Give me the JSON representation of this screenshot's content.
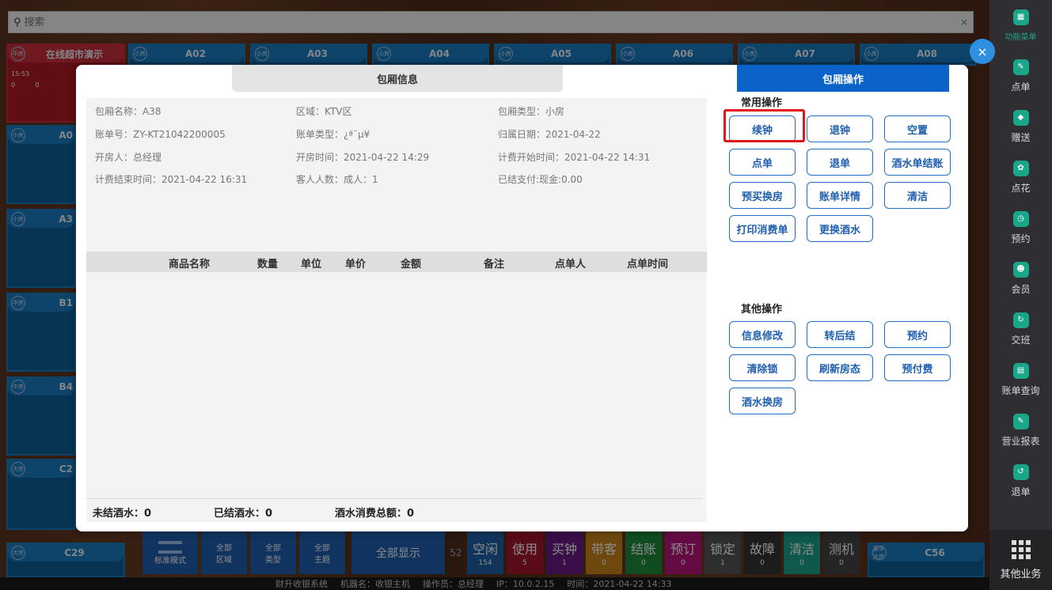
{
  "search": {
    "placeholder": "搜索",
    "clear": "×"
  },
  "tiles_top": [
    {
      "badge": "中房",
      "name": "在线超市演示",
      "time": "15:53",
      "c1": "0",
      "c2": "0"
    },
    {
      "badge": "小房",
      "name": "A02"
    },
    {
      "badge": "小房",
      "name": "A03"
    },
    {
      "badge": "小房",
      "name": "A04"
    },
    {
      "badge": "小房",
      "name": "A05"
    },
    {
      "badge": "小房",
      "name": "A06"
    },
    {
      "badge": "小房",
      "name": "A07"
    },
    {
      "badge": "小房",
      "name": "A08"
    }
  ],
  "tiles_left": [
    {
      "badge": "小房",
      "name": "A0"
    },
    {
      "badge": "小房",
      "name": "A3"
    },
    {
      "badge": "中房",
      "name": "B1"
    },
    {
      "badge": "中房",
      "name": "B4"
    },
    {
      "badge": "大房",
      "name": "C2"
    },
    {
      "badge": "大房",
      "name": "C29"
    }
  ],
  "tile_right_bottom": {
    "badge": "豪华大房",
    "name": "C56"
  },
  "sidebar": {
    "items": [
      "功能菜单",
      "点单",
      "赠送",
      "点花",
      "预约",
      "会员",
      "交班",
      "账单查询",
      "营业报表",
      "退单"
    ],
    "bottom": "其他业务"
  },
  "toolbar": {
    "mode": "标准模式",
    "area": [
      "全部",
      "区域"
    ],
    "type": [
      "全部",
      "类型"
    ],
    "theme": [
      "全部",
      "主题"
    ],
    "show_all": "全部显示",
    "stats": [
      {
        "label": "空闲",
        "count": "154",
        "color": "#1f5fa6"
      },
      {
        "label": "使用",
        "count": "5",
        "color": "#a3142a"
      },
      {
        "label": "买钟",
        "count": "1",
        "color": "#6b1b86"
      },
      {
        "label": "带客",
        "count": "0",
        "color": "#c8841a"
      },
      {
        "label": "结账",
        "count": "0",
        "color": "#1f8a3c"
      },
      {
        "label": "预订",
        "count": "0",
        "color": "#b9157c"
      },
      {
        "label": "锁定",
        "count": "1",
        "color": "#555555"
      },
      {
        "label": "故障",
        "count": "0",
        "color": "#333333"
      },
      {
        "label": "清洁",
        "count": "0",
        "color": "#1aa08a"
      },
      {
        "label": "测机",
        "count": "0",
        "color": "#444444"
      }
    ],
    "stat_partial": "52"
  },
  "statusbar": [
    "财升收银系统",
    "机器名：收银主机",
    "操作员：总经理",
    "IP：10.0.2.15",
    "时间：2021-04-22 14:33"
  ],
  "modal": {
    "info_title": "包厢信息",
    "info": {
      "room_name": "包厢名称：A38",
      "area": "区域：KTV区",
      "room_type": "包厢类型：小房",
      "bill_no": "账单号：ZY-KT21042200005",
      "bill_type": "账单类型：¿ª¨µ¥",
      "belong_date": "归属日期：2021-04-22",
      "opener": "开房人：总经理",
      "open_time": "开房时间：2021-04-22 14:29",
      "charge_start": "计费开始时间：2021-04-22 14:31",
      "charge_end": "计费结束时间：2021-04-22 16:31",
      "guests": "客人人数：成人：1",
      "paid": "已结支付:现金:0.00"
    },
    "columns": [
      "商品名称",
      "数量",
      "单位",
      "单价",
      "金额",
      "备注",
      "点单人",
      "点单时间"
    ],
    "footer": {
      "unsettled": "未结酒水：0",
      "settled": "已结酒水：0",
      "total": "酒水消费总额：0"
    },
    "ops_title": "包厢操作",
    "common_title": "常用操作",
    "common_ops": [
      "续钟",
      "退钟",
      "空置",
      "点单",
      "退单",
      "酒水单结账",
      "预买换房",
      "账单详情",
      "清洁",
      "打印消费单",
      "更换酒水"
    ],
    "other_title": "其他操作",
    "other_ops": [
      "信息修改",
      "转后结",
      "预约",
      "清除锁",
      "刷新房态",
      "预付费",
      "酒水换房"
    ],
    "close": "×"
  }
}
